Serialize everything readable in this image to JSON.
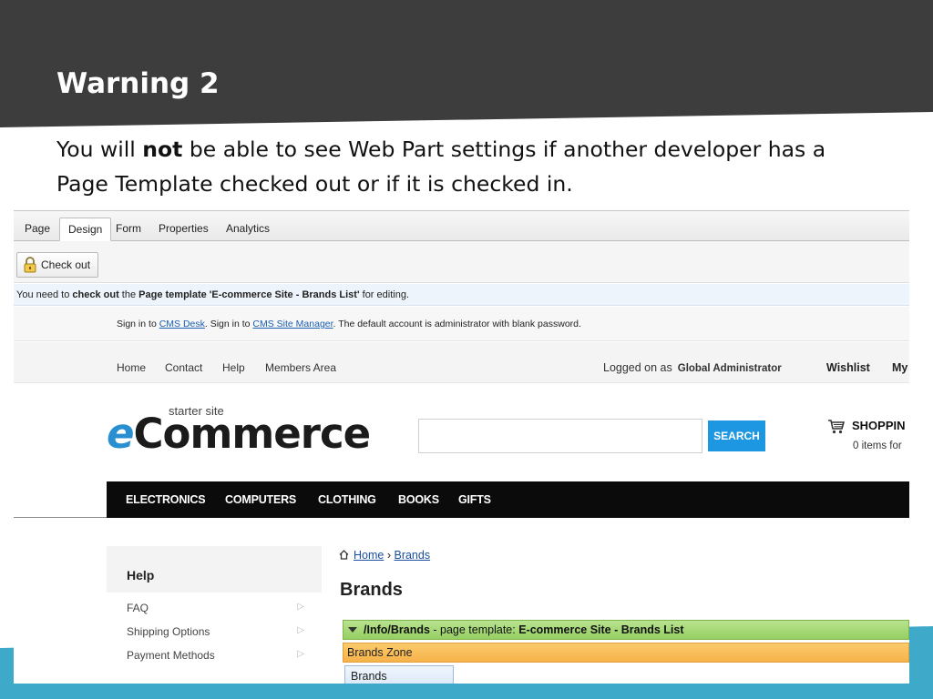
{
  "slide": {
    "title": "Warning 2",
    "body_pre": "You will ",
    "body_bold": "not",
    "body_post": " be able to see Web Part settings if another developer has a Page Template checked out or if it is checked in."
  },
  "admin": {
    "tabs": [
      "Page",
      "Design",
      "Form",
      "Properties",
      "Analytics"
    ],
    "active_tab": "Design",
    "checkout_label": "Check out",
    "info": {
      "pre": "You need to ",
      "bold1": "check out",
      "mid": " the ",
      "bold2": "Page template 'E-commerce Site - Brands List'",
      "post": " for editing."
    }
  },
  "site": {
    "signin": {
      "t1": "Sign in to ",
      "link1": "CMS Desk",
      "t2": ". Sign in to ",
      "link2": "CMS Site Manager",
      "t3": ". The default account is administrator with blank password."
    },
    "topnav": [
      "Home",
      "Contact",
      "Help",
      "Members Area"
    ],
    "logged_label": "Logged on as",
    "logged_user": "Global Administrator",
    "wishlist": "Wishlist",
    "my": "My",
    "logo_small": "starter site",
    "logo_e": "e",
    "logo_rest": "Commerce",
    "search_button": "SEARCH",
    "cart_title": "SHOPPIN",
    "cart_sub": "0 items for",
    "categories": [
      "ELECTRONICS",
      "COMPUTERS",
      "CLOTHING",
      "BOOKS",
      "GIFTS"
    ],
    "help_title": "Help",
    "help_items": [
      "FAQ",
      "Shipping Options",
      "Payment Methods"
    ],
    "breadcrumb": {
      "home": "Home",
      "sep": "›",
      "current": "Brands"
    },
    "page_heading": "Brands",
    "template_bar": {
      "path": "/Info/Brands",
      "mid": " - page template: ",
      "name": "E-commerce Site - Brands List"
    },
    "zone": "Brands Zone",
    "webpart": "Brands"
  },
  "colors": {
    "header_dark": "#3d3d3d",
    "accent_blue": "#3fa9c9",
    "search_blue": "#1d97e1",
    "template_green": "#96cf62",
    "zone_orange": "#f6b24a"
  }
}
